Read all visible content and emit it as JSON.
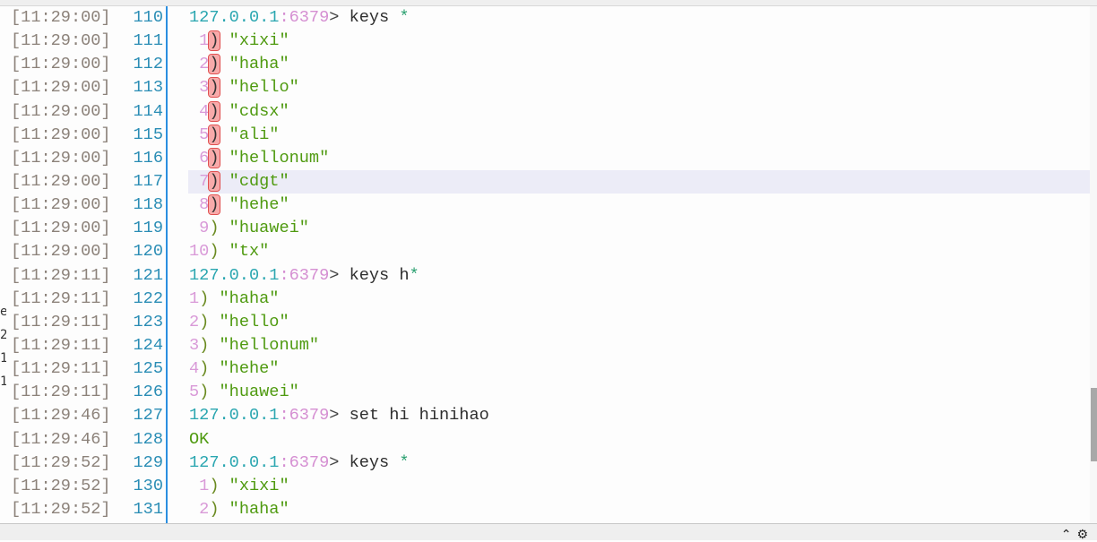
{
  "left_panel_fragments": [
    "e",
    "2",
    "1",
    "1"
  ],
  "gutter": [
    {
      "ts": "[11:29:00]",
      "ln": "110"
    },
    {
      "ts": "[11:29:00]",
      "ln": "111"
    },
    {
      "ts": "[11:29:00]",
      "ln": "112"
    },
    {
      "ts": "[11:29:00]",
      "ln": "113"
    },
    {
      "ts": "[11:29:00]",
      "ln": "114"
    },
    {
      "ts": "[11:29:00]",
      "ln": "115"
    },
    {
      "ts": "[11:29:00]",
      "ln": "116"
    },
    {
      "ts": "[11:29:00]",
      "ln": "117"
    },
    {
      "ts": "[11:29:00]",
      "ln": "118"
    },
    {
      "ts": "[11:29:00]",
      "ln": "119"
    },
    {
      "ts": "[11:29:00]",
      "ln": "120"
    },
    {
      "ts": "[11:29:11]",
      "ln": "121"
    },
    {
      "ts": "[11:29:11]",
      "ln": "122"
    },
    {
      "ts": "[11:29:11]",
      "ln": "123"
    },
    {
      "ts": "[11:29:11]",
      "ln": "124"
    },
    {
      "ts": "[11:29:11]",
      "ln": "125"
    },
    {
      "ts": "[11:29:11]",
      "ln": "126"
    },
    {
      "ts": "[11:29:46]",
      "ln": "127"
    },
    {
      "ts": "[11:29:46]",
      "ln": "128"
    },
    {
      "ts": "[11:29:52]",
      "ln": "129"
    },
    {
      "ts": "[11:29:52]",
      "ln": "130"
    },
    {
      "ts": "[11:29:52]",
      "ln": "131"
    }
  ],
  "highlighted_line": "117",
  "lines": [
    [
      {
        "t": "127.0.0.1",
        "c": "ip"
      },
      {
        "t": ":6379",
        "c": "port"
      },
      {
        "t": "> ",
        "c": "gt"
      },
      {
        "t": "keys ",
        "c": "cmd"
      },
      {
        "t": "*",
        "c": "star"
      }
    ],
    [
      {
        "t": " 1",
        "c": "num"
      },
      {
        "t": ")",
        "c": "mark"
      },
      {
        "t": " \"xixi\"",
        "c": "str"
      }
    ],
    [
      {
        "t": " 2",
        "c": "num"
      },
      {
        "t": ")",
        "c": "mark"
      },
      {
        "t": " \"haha\"",
        "c": "str"
      }
    ],
    [
      {
        "t": " 3",
        "c": "num"
      },
      {
        "t": ")",
        "c": "mark"
      },
      {
        "t": " \"hello\"",
        "c": "str"
      }
    ],
    [
      {
        "t": " 4",
        "c": "num"
      },
      {
        "t": ")",
        "c": "mark"
      },
      {
        "t": " \"cdsx\"",
        "c": "str"
      }
    ],
    [
      {
        "t": " 5",
        "c": "num"
      },
      {
        "t": ")",
        "c": "mark"
      },
      {
        "t": " \"ali\"",
        "c": "str"
      }
    ],
    [
      {
        "t": " 6",
        "c": "num"
      },
      {
        "t": ")",
        "c": "mark"
      },
      {
        "t": " \"hellonum\"",
        "c": "str"
      }
    ],
    [
      {
        "t": " 7",
        "c": "num"
      },
      {
        "t": ")",
        "c": "mark"
      },
      {
        "t": " \"cdgt\"",
        "c": "str"
      }
    ],
    [
      {
        "t": " 8",
        "c": "num"
      },
      {
        "t": ")",
        "c": "mark"
      },
      {
        "t": " \"hehe\"",
        "c": "str"
      }
    ],
    [
      {
        "t": " 9",
        "c": "num"
      },
      {
        "t": ")",
        "c": "par"
      },
      {
        "t": " \"huawei\"",
        "c": "str"
      }
    ],
    [
      {
        "t": "10",
        "c": "num"
      },
      {
        "t": ")",
        "c": "par"
      },
      {
        "t": " \"tx\"",
        "c": "str"
      }
    ],
    [
      {
        "t": "127.0.0.1",
        "c": "ip"
      },
      {
        "t": ":6379",
        "c": "port"
      },
      {
        "t": "> ",
        "c": "gt"
      },
      {
        "t": "keys h",
        "c": "cmd"
      },
      {
        "t": "*",
        "c": "star"
      }
    ],
    [
      {
        "t": "1",
        "c": "num"
      },
      {
        "t": ")",
        "c": "par"
      },
      {
        "t": " \"haha\"",
        "c": "str"
      }
    ],
    [
      {
        "t": "2",
        "c": "num"
      },
      {
        "t": ")",
        "c": "par"
      },
      {
        "t": " \"hello\"",
        "c": "str"
      }
    ],
    [
      {
        "t": "3",
        "c": "num"
      },
      {
        "t": ")",
        "c": "par"
      },
      {
        "t": " \"hellonum\"",
        "c": "str"
      }
    ],
    [
      {
        "t": "4",
        "c": "num"
      },
      {
        "t": ")",
        "c": "par"
      },
      {
        "t": " \"hehe\"",
        "c": "str"
      }
    ],
    [
      {
        "t": "5",
        "c": "num"
      },
      {
        "t": ")",
        "c": "par"
      },
      {
        "t": " \"huawei\"",
        "c": "str"
      }
    ],
    [
      {
        "t": "127.0.0.1",
        "c": "ip"
      },
      {
        "t": ":6379",
        "c": "port"
      },
      {
        "t": "> ",
        "c": "gt"
      },
      {
        "t": "set hi hinihao",
        "c": "cmd"
      }
    ],
    [
      {
        "t": "OK",
        "c": "ok"
      }
    ],
    [
      {
        "t": "127.0.0.1",
        "c": "ip"
      },
      {
        "t": ":6379",
        "c": "port"
      },
      {
        "t": "> ",
        "c": "gt"
      },
      {
        "t": "keys ",
        "c": "cmd"
      },
      {
        "t": "*",
        "c": "star"
      }
    ],
    [
      {
        "t": " 1",
        "c": "num"
      },
      {
        "t": ")",
        "c": "par"
      },
      {
        "t": " \"xixi\"",
        "c": "str"
      }
    ],
    [
      {
        "t": " 2",
        "c": "num"
      },
      {
        "t": ")",
        "c": "par"
      },
      {
        "t": " \"haha\"",
        "c": "str"
      }
    ]
  ],
  "status_icons": [
    "up-arrow-icon",
    "gear-icon"
  ],
  "colors": {
    "divider": "#2b8fe0",
    "highlight": "#ececf7",
    "timestamp": "#8c827a",
    "line_number": "#2a8db5",
    "string": "#4f9a10",
    "index": "#d99ad8"
  }
}
